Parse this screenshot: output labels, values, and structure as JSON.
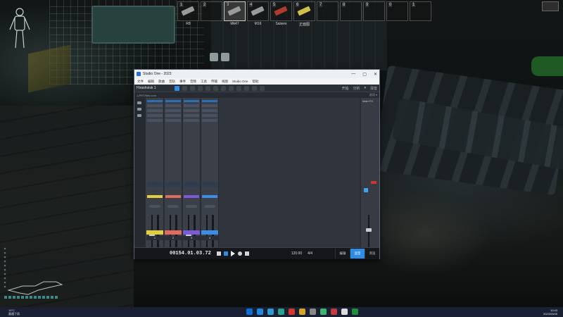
{
  "hotbar": {
    "slots": [
      {
        "num": "1",
        "label": "R8"
      },
      {
        "num": "2",
        "label": ""
      },
      {
        "num": "3",
        "label": "Mk47"
      },
      {
        "num": "4",
        "label": "M16"
      },
      {
        "num": "5",
        "label": "Saiwex"
      },
      {
        "num": "6",
        "label": "正面图"
      },
      {
        "num": "7",
        "label": ""
      },
      {
        "num": "8",
        "label": ""
      },
      {
        "num": "9",
        "label": ""
      },
      {
        "num": "0",
        "label": ""
      },
      {
        "num": "1",
        "label": ""
      }
    ],
    "selected_index": 2
  },
  "window": {
    "title": "Studio One - 2023",
    "controls": [
      "—",
      "▢",
      "✕"
    ],
    "menu": [
      "文件",
      "编辑",
      "歌曲",
      "音轨",
      "事件",
      "音频",
      "工具",
      "传输",
      "视图",
      "Studio One",
      "帮助"
    ],
    "song_name": "Hirashoisk 1",
    "right_info": [
      "开始",
      "分析",
      "▾",
      "混音"
    ],
    "sub_left": "1-PRT/Mrs.com",
    "sub_right": "选项 ▾",
    "main_out_title": "Main FX",
    "channels": [
      {
        "name": "",
        "color": "#e3cf3a",
        "foot": "1",
        "fader": 0.55,
        "meter": 0.0
      },
      {
        "name": "",
        "color": "#e36a5e",
        "foot": "2",
        "fader": 0.45,
        "meter": 0.0
      },
      {
        "name": "",
        "color": "#7a5ad6",
        "foot": "3",
        "fader": 0.5,
        "meter": 0.0
      },
      {
        "name": "",
        "color": "#3a8ee6",
        "foot": "4",
        "fader": 0.6,
        "meter": 0.0
      }
    ],
    "transport": {
      "time": "00154.01.03.72",
      "tempo": "120.00",
      "signature": "4/4",
      "tabs": [
        "编辑",
        "混音",
        "浏览"
      ],
      "active_tab": 1
    }
  },
  "taskbar": {
    "weather_temp": "19°C",
    "weather_desc": "晨遇下雨",
    "time": "10:43",
    "date": "2023/03/05",
    "icon_colors": [
      "#0b6fd8",
      "#1e88e5",
      "#2b9ad0",
      "#2aa08a",
      "#d6362c",
      "#d4a422",
      "#888888",
      "#3cb371",
      "#c23a3a",
      "#dcdcdc",
      "#1f8f3a"
    ]
  }
}
